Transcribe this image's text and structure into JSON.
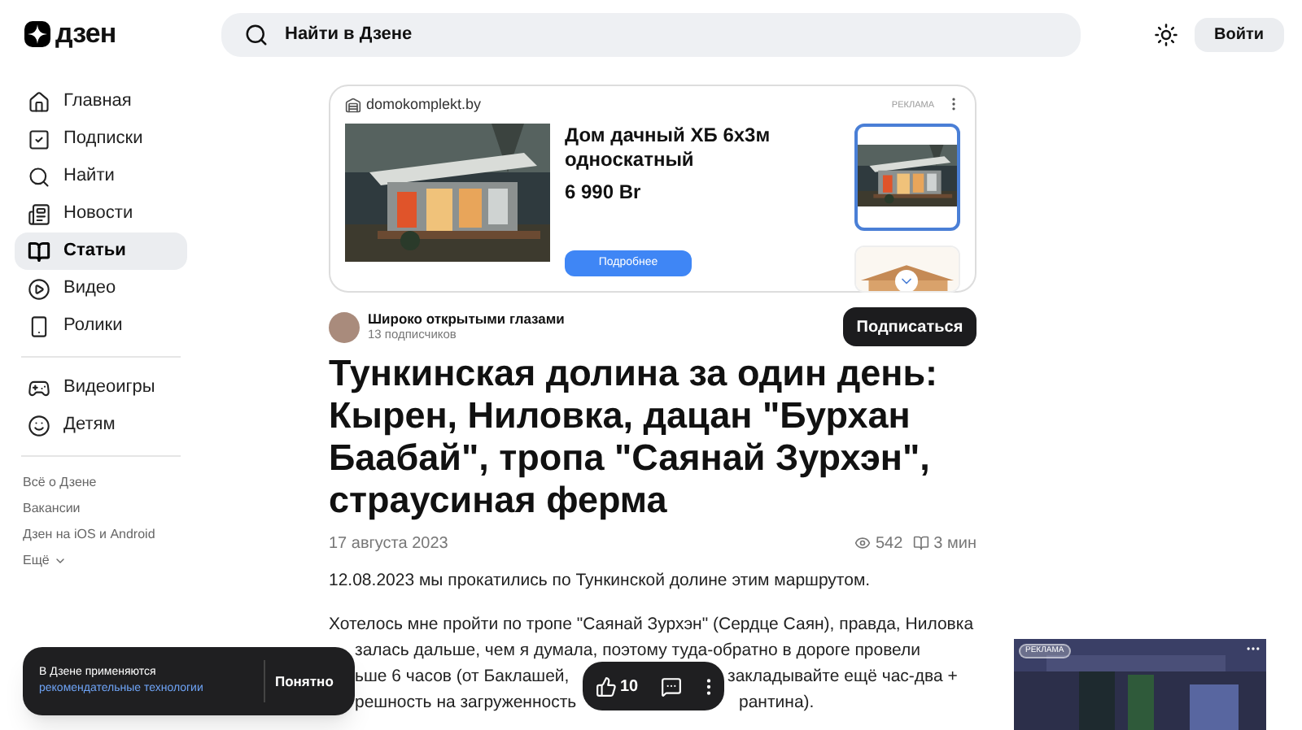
{
  "header": {
    "logo": "дзен",
    "search": {
      "placeholder": "Найти в Дзене"
    },
    "login": "Войти"
  },
  "sidebar": {
    "items": [
      {
        "label": "Главная",
        "kind": "home",
        "selected": false
      },
      {
        "label": "Подписки",
        "kind": "subscriptions",
        "selected": false
      },
      {
        "label": "Найти",
        "kind": "search",
        "selected": false
      },
      {
        "label": "Новости",
        "kind": "news",
        "selected": false
      },
      {
        "label": "Статьи",
        "kind": "articles",
        "selected": true
      },
      {
        "label": "Видео",
        "kind": "video",
        "selected": false
      },
      {
        "label": "Ролики",
        "kind": "clips",
        "selected": false
      }
    ],
    "extra": [
      {
        "label": "Видеоигры",
        "kind": "games",
        "selected": false
      },
      {
        "label": "Детям",
        "kind": "kids",
        "selected": false
      }
    ],
    "footer_links": [
      "Всё о Дзене",
      "Вакансии",
      "Дзен на iOS и Android"
    ],
    "more": "Ещё"
  },
  "ad": {
    "domain": "domokomplekt.by",
    "label": "РЕКЛАМА",
    "title": "Дом дачный ХБ 6х3м односкатный",
    "price": "6 990 Br",
    "button": "Подробнее",
    "thumbnails": [
      {
        "selected": true
      },
      {
        "selected": false
      }
    ]
  },
  "channel": {
    "name": "Широко открытыми глазами",
    "subscribers": "13 подписчиков",
    "subscribe": "Подписаться"
  },
  "article": {
    "title": "Тункинская долина за один день: Кырен, Ниловка, дацан \"Бурхан Баабай\", тропа \"Саянай Зурхэн\", страусиная ферма",
    "date": "17 августа 2023",
    "views": "542",
    "read_time": "3 мин",
    "intro": "12.08.2023 мы прокатились по Тункинской долине этим маршрутом.",
    "lines": [
      {
        "segments": [
          "Хотелось мне пройти по тропе \"Саянай Зурхэн\" (Сердце Саян), правда, Ниловка"
        ]
      },
      {
        "segments": [
          "залась дальше, чем я думала, поэтому туда-обратно в дороге провели"
        ]
      },
      {
        "segments": [
          "ьше 6 часов (от Баклашей,",
          "закладывайте ещё час-два +"
        ]
      },
      {
        "segments": [
          "решность на загруженность",
          "рантина)."
        ]
      }
    ]
  },
  "cookie": {
    "text": "В Дзене применяются",
    "link": "рекомендательные технологии",
    "button": "Понятно"
  },
  "action_bar": {
    "likes": "10"
  },
  "side_ad": {
    "label": "РЕКЛАМА"
  }
}
